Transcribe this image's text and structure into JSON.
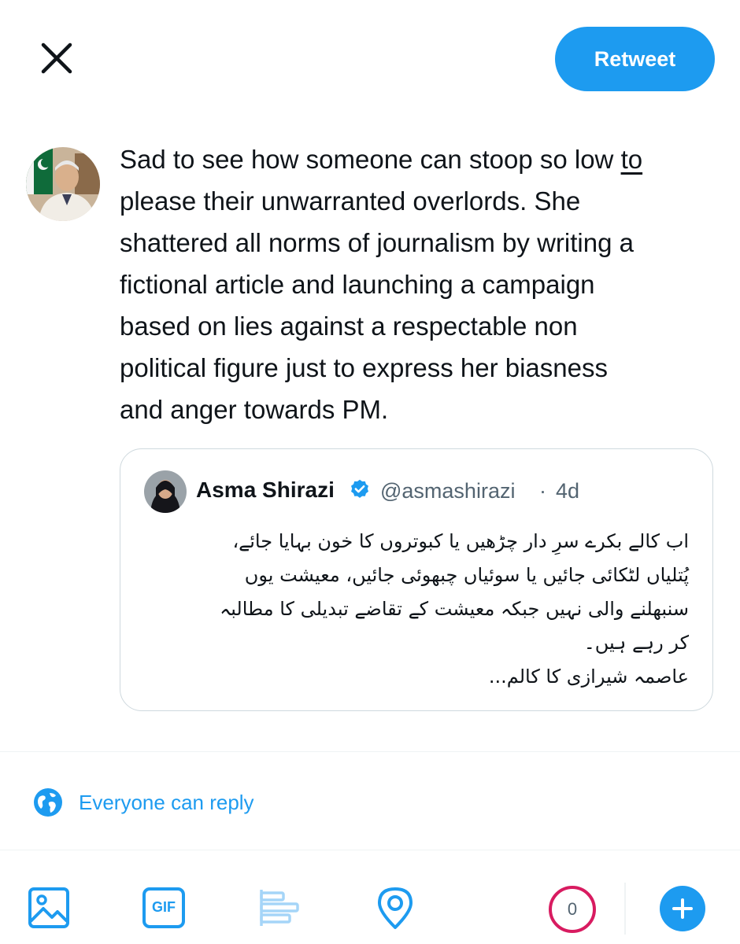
{
  "header": {
    "close_icon": "close-icon",
    "retweet_label": "Retweet"
  },
  "composer": {
    "avatar": "author-avatar",
    "text_lines": [
      "Sad to see how someone can stoop so low ",
      "to",
      "please their unwarranted overlords. She",
      "shattered all norms of journalism by writing a",
      "fictional article and launching a campaign",
      "based on lies against a respectable non",
      "political figure just to express her biasness",
      "and anger towards PM."
    ]
  },
  "quoted_tweet": {
    "name": "Asma Shirazi",
    "verified": true,
    "handle": "@asmashirazi",
    "separator": "·",
    "time": "4d",
    "body": "اب کالے بکرے سرِ دار چڑھیں یا کبوتروں کا خون بہایا جائے،\nپُتلیاں لٹکائی جائیں یا سوئیاں چبھوئی جائیں، معیشت یوں\nسنبھلنے والی نہیں جبکہ معیشت کے تقاضے تبدیلی کا مطالبہ\nکر رہے ہیں۔\nعاصمہ شیرازی کا کالم..."
  },
  "reply_setting": {
    "icon": "globe-icon",
    "label": "Everyone can reply"
  },
  "toolbar": {
    "icons": [
      "image-icon",
      "gif-icon",
      "poll-icon",
      "location-icon"
    ],
    "gif_label": "GIF",
    "char_count": "0",
    "add_icon": "plus-icon"
  },
  "colors": {
    "accent": "#1d9bf0",
    "counter_ring": "#d81b60",
    "text": "#0f1419",
    "muted": "#536471",
    "border": "#cfd9de"
  }
}
